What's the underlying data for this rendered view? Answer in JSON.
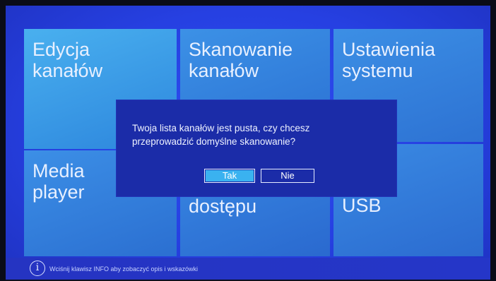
{
  "tiles": [
    {
      "label": "Edycja\nkanałów"
    },
    {
      "label": "Skanowanie\nkanałów"
    },
    {
      "label": "Ustawienia\nsystemu"
    },
    {
      "label": "Media\nplayer"
    },
    {
      "label": "dostępu"
    },
    {
      "label": "USB"
    }
  ],
  "dialog": {
    "message": "Twoja lista kanałów jest pusta, czy chcesz\nprzeprowadzić domyślne skanowanie?",
    "yes_label": "Tak",
    "no_label": "Nie"
  },
  "help_bar": {
    "icon": "info-icon",
    "icon_glyph": "i",
    "text": "Wciśnij klawisz INFO aby zobaczyć opis i wskazówki"
  },
  "colors": {
    "background": "#2640e2",
    "dialog": "#1b2ca8",
    "selected_button": "#3ab2f0"
  }
}
